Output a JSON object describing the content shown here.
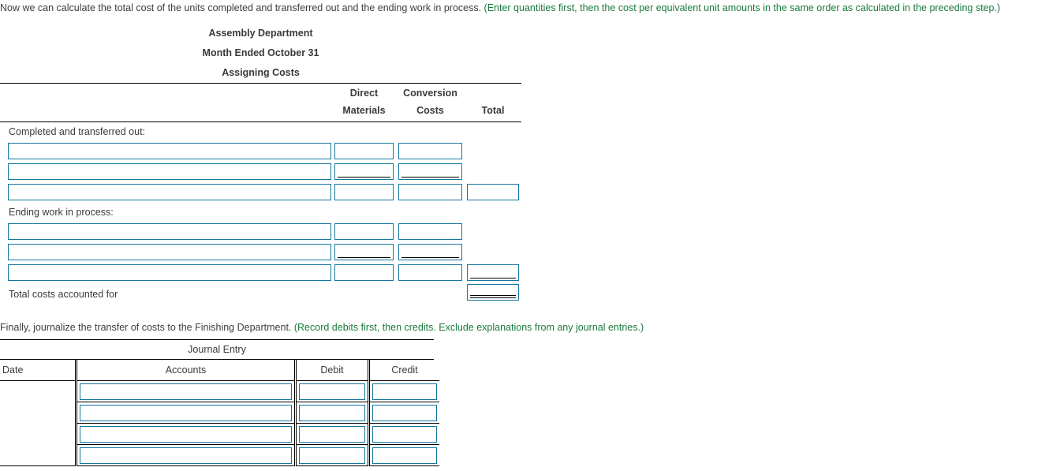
{
  "intro": {
    "text": "Now we can calculate the total cost of the units completed and transferred out and the ending work in process. ",
    "hint": "(Enter quantities first, then the cost per equivalent unit amounts in the same order as calculated in the preceding step.)"
  },
  "schedule": {
    "title_line_1": "Assembly Department",
    "title_line_2": "Month Ended October 31",
    "title_line_3": "Assigning Costs",
    "columns": {
      "direct_materials_line1": "Direct",
      "direct_materials_line2": "Materials",
      "conversion_costs_line1": "Conversion",
      "conversion_costs_line2": "Costs",
      "total": "Total"
    },
    "section_1_label": "Completed and transferred out:",
    "section_1_rows": [
      {
        "desc": "",
        "direct_materials": "",
        "conversion_costs": "",
        "total": "",
        "dm_rule": "none",
        "cc_rule": "none",
        "total_rule": "none",
        "has_total": false
      },
      {
        "desc": "",
        "direct_materials": "",
        "conversion_costs": "",
        "total": "",
        "dm_rule": "single",
        "cc_rule": "single",
        "total_rule": "none",
        "has_total": false
      },
      {
        "desc": "",
        "direct_materials": "",
        "conversion_costs": "",
        "total": "",
        "dm_rule": "none",
        "cc_rule": "none",
        "total_rule": "none",
        "has_total": true
      }
    ],
    "section_2_label": "Ending work in process:",
    "section_2_rows": [
      {
        "desc": "",
        "direct_materials": "",
        "conversion_costs": "",
        "total": "",
        "dm_rule": "none",
        "cc_rule": "none",
        "total_rule": "none",
        "has_total": false
      },
      {
        "desc": "",
        "direct_materials": "",
        "conversion_costs": "",
        "total": "",
        "dm_rule": "single",
        "cc_rule": "single",
        "total_rule": "none",
        "has_total": false
      },
      {
        "desc": "",
        "direct_materials": "",
        "conversion_costs": "",
        "total": "",
        "dm_rule": "none",
        "cc_rule": "none",
        "total_rule": "single",
        "has_total": true
      }
    ],
    "total_label": "Total costs accounted for",
    "total_value": "",
    "total_rule": "double"
  },
  "journal": {
    "intro_text": "Finally, journalize the transfer of costs to the Finishing Department. ",
    "intro_hint": "(Record debits first, then credits. Exclude explanations from any journal entries.)",
    "title": "Journal Entry",
    "headers": {
      "date": "Date",
      "accounts": "Accounts",
      "debit": "Debit",
      "credit": "Credit"
    },
    "date_value": "",
    "rows": [
      {
        "account": "",
        "debit": "",
        "credit": ""
      },
      {
        "account": "",
        "debit": "",
        "credit": ""
      },
      {
        "account": "",
        "debit": "",
        "credit": ""
      },
      {
        "account": "",
        "debit": "",
        "credit": ""
      }
    ]
  },
  "colors": {
    "field_border": "#1477a0",
    "hint_green": "#1a7a3c",
    "text": "#3a3a3a",
    "rule": "#000000"
  }
}
